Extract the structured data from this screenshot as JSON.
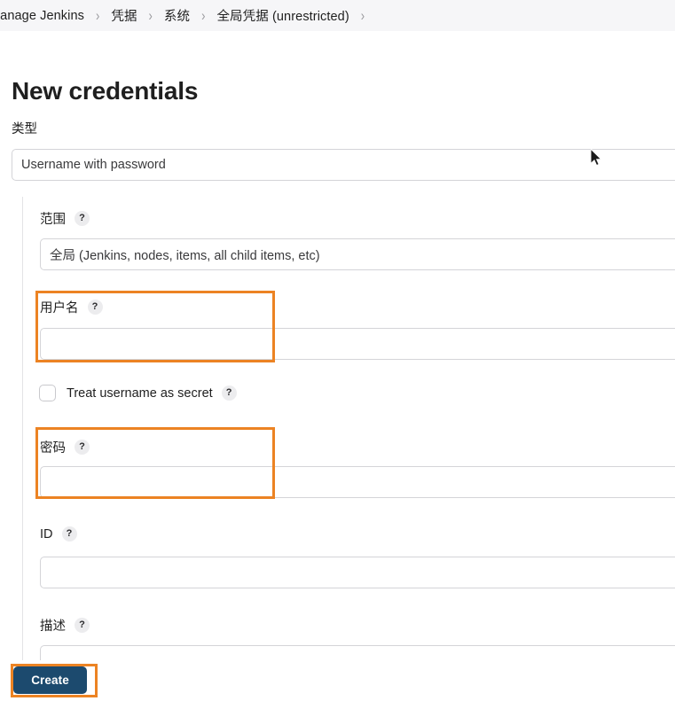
{
  "breadcrumb": {
    "separator": "›",
    "items": [
      {
        "label": "Manage Jenkins"
      },
      {
        "label": "凭据"
      },
      {
        "label": "系统"
      },
      {
        "label": "全局凭据 (unrestricted)"
      }
    ],
    "trailing_separator": "›"
  },
  "page": {
    "title": "New credentials"
  },
  "type_field": {
    "label": "类型",
    "selected": "Username with password"
  },
  "form": {
    "scope": {
      "label": "范围",
      "help": "?",
      "selected": "全局 (Jenkins, nodes, items, all child items, etc)"
    },
    "username": {
      "label": "用户名",
      "help": "?",
      "value": "",
      "placeholder": ""
    },
    "treat_username_as_secret": {
      "label": "Treat username as secret",
      "help": "?",
      "checked": false
    },
    "password": {
      "label": "密码",
      "help": "?",
      "value": "",
      "placeholder": ""
    },
    "id": {
      "label": "ID",
      "help": "?",
      "value": "",
      "placeholder": ""
    },
    "description": {
      "label": "描述",
      "help": "?",
      "value": "",
      "placeholder": ""
    }
  },
  "footer": {
    "create_label": "Create"
  },
  "colors": {
    "annotation": "#ec8323",
    "primary_button": "#1c4a6e",
    "breadcrumb_bg": "#f6f6f8",
    "input_border": "#d4d4d8"
  }
}
